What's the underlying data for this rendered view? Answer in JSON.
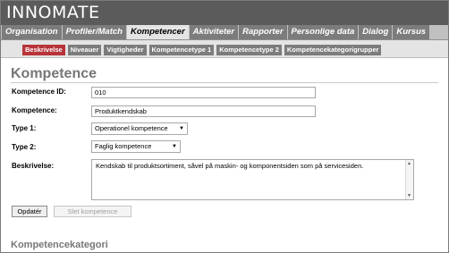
{
  "app": {
    "logo": "INNOMATE"
  },
  "main_tabs": [
    {
      "label": "Organisation",
      "active": false
    },
    {
      "label": "Profiler/Match",
      "active": false
    },
    {
      "label": "Kompetencer",
      "active": true
    },
    {
      "label": "Aktiviteter",
      "active": false
    },
    {
      "label": "Rapporter",
      "active": false
    },
    {
      "label": "Personlige data",
      "active": false
    },
    {
      "label": "Dialog",
      "active": false
    },
    {
      "label": "Kursus",
      "active": false
    }
  ],
  "sub_tabs": [
    {
      "label": "Beskrivelse",
      "active": true
    },
    {
      "label": "Niveauer",
      "active": false
    },
    {
      "label": "Vigtigheder",
      "active": false
    },
    {
      "label": "Kompetencetype 1",
      "active": false
    },
    {
      "label": "Kompetencetype 2",
      "active": false
    },
    {
      "label": "Kompetencekategorigrupper",
      "active": false
    }
  ],
  "page": {
    "title": "Kompetence"
  },
  "form": {
    "id_label": "Kompetence ID:",
    "id_value": "010",
    "name_label": "Kompetence:",
    "name_value": "Produktkendskab",
    "type1_label": "Type 1:",
    "type1_value": "Operationel kompetence",
    "type2_label": "Type 2:",
    "type2_value": "Faglig kompetence",
    "desc_label": "Beskrivelse:",
    "desc_value": "Kendskab til produktsortiment, såvel på maskin- og komponentsiden som på servicesiden."
  },
  "buttons": {
    "update": "Opdatér",
    "delete": "Slet kompetence"
  },
  "section": {
    "category_title": "Kompetencekategori"
  },
  "icons": {
    "dropdown": "chevron-down-icon",
    "scroll_up": "scroll-up-icon",
    "scroll_down": "scroll-down-icon"
  },
  "colors": {
    "active_subtab": "#b8343a",
    "tab_gray": "#7c7c7c",
    "title_gray": "#777777"
  }
}
